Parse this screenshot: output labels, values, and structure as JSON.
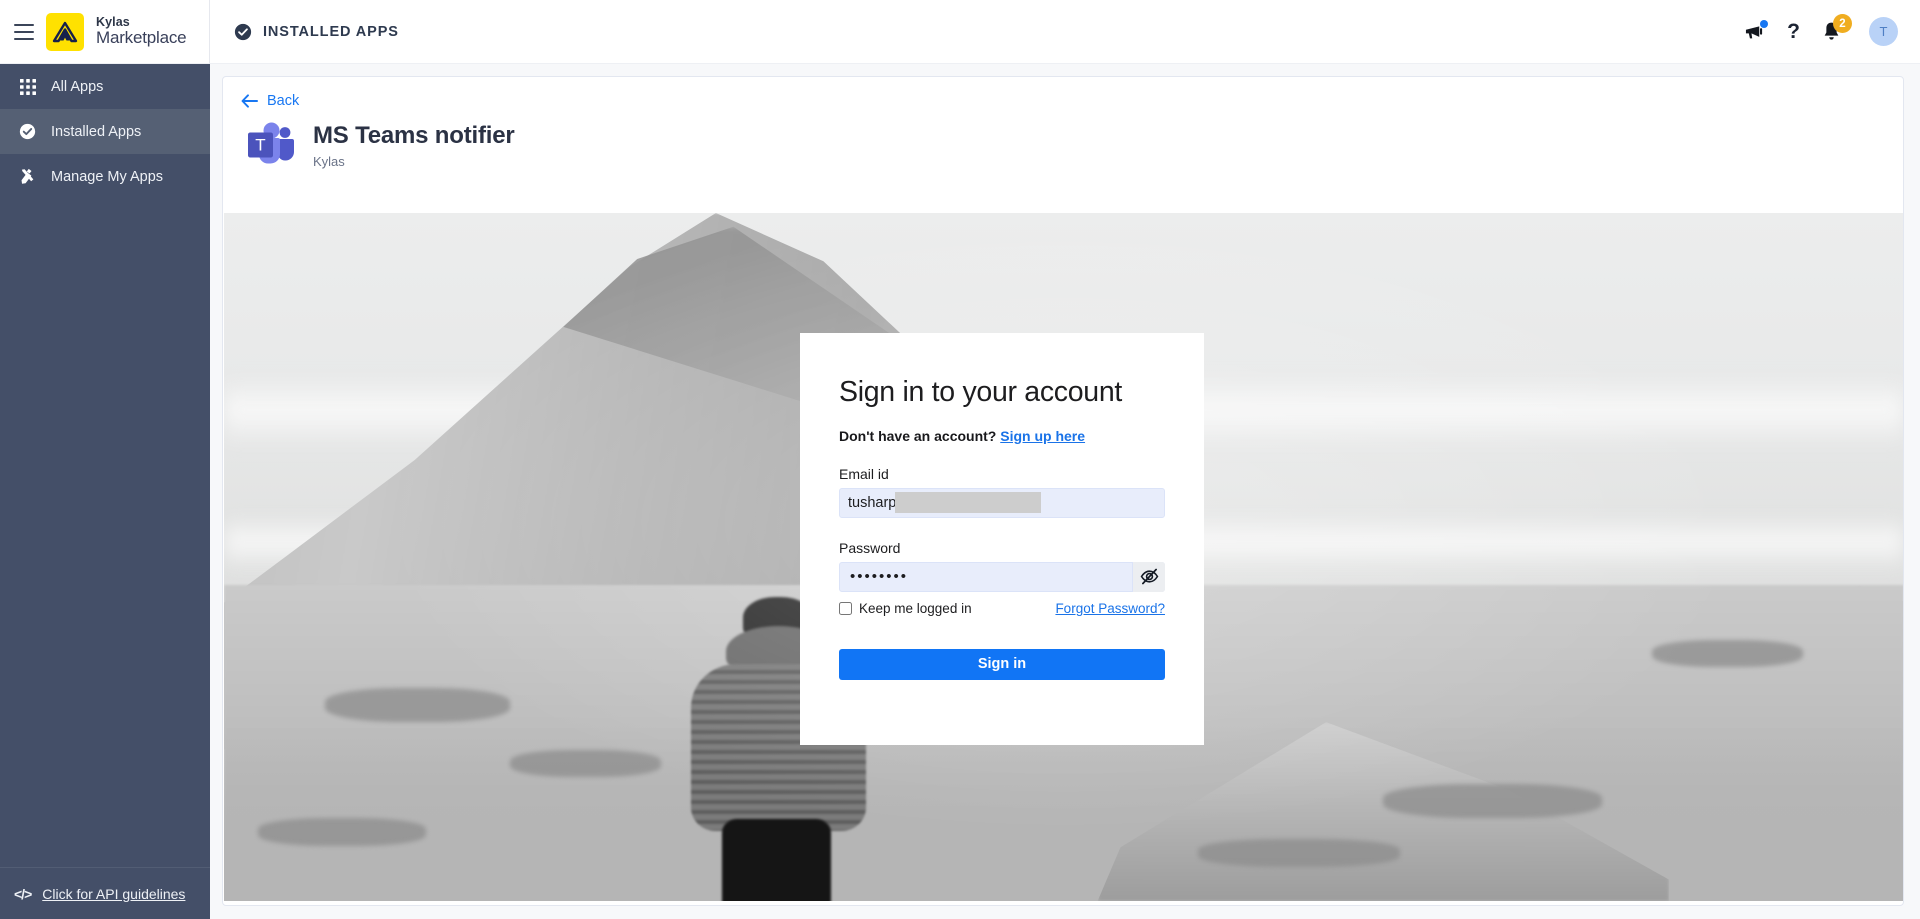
{
  "brand": {
    "line1": "Kylas",
    "line2": "Marketplace",
    "logo_icon": "kylas-mountain-logo",
    "logo_color": "#ffe100",
    "menu_icon": "hamburger-menu-icon"
  },
  "header": {
    "section_icon": "check-circle-icon",
    "section_label": "INSTALLED APPS",
    "actions": {
      "announcement_icon": "megaphone-icon",
      "announcement_dot": true,
      "help_icon": "question-mark-icon",
      "help_label": "?",
      "notifications_icon": "bell-icon",
      "notifications_count": "2",
      "avatar_initial": "T"
    },
    "accent_blue": "#1877f2",
    "badge_amber": "#f0ad20"
  },
  "sidebar": {
    "background": "#444f68",
    "active_background": "#556074",
    "items": [
      {
        "label": "All Apps",
        "icon": "grid-apps-icon",
        "active": false
      },
      {
        "label": "Installed Apps",
        "icon": "check-circle-icon",
        "active": true
      },
      {
        "label": "Manage My Apps",
        "icon": "tools-icon",
        "active": false
      }
    ],
    "footer": {
      "label": "Click for API guidelines",
      "icon": "code-brackets-icon"
    }
  },
  "main": {
    "back_label": "Back",
    "back_icon": "arrow-left-icon",
    "app_icon": "ms-teams-logo",
    "app_title": "MS Teams notifier",
    "app_vendor": "Kylas"
  },
  "signin": {
    "title": "Sign in to your account",
    "prompt": "Don't have an account?",
    "signup_link": "Sign up here",
    "email_label": "Email id",
    "email_value": "tusharp",
    "email_redacted": true,
    "password_label": "Password",
    "password_value": "••••••••",
    "toggle_password_icon": "eye-off-icon",
    "keep_logged_in_label": "Keep me logged in",
    "keep_logged_in_checked": false,
    "forgot_label": "Forgot Password?",
    "submit_label": "Sign in",
    "submit_color": "#1175f5",
    "link_color": "#1a73e8",
    "background_photo": "grayscale-mountain-hiker-photo"
  }
}
